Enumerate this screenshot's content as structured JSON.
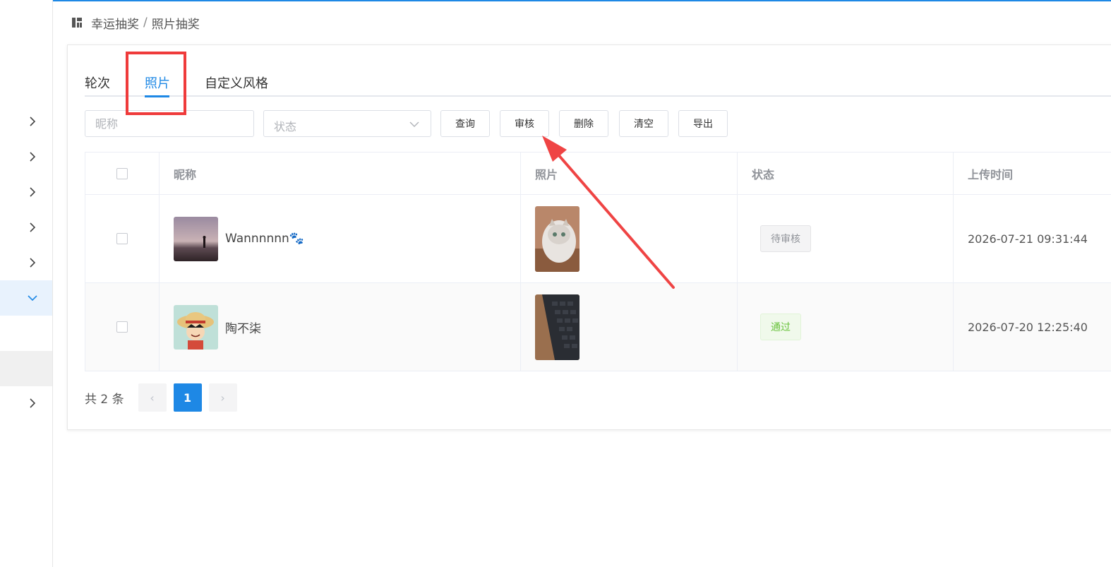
{
  "breadcrumb": {
    "parent": "幸运抽奖",
    "separator": "/",
    "current": "照片抽奖"
  },
  "tabs": [
    {
      "label": "轮次"
    },
    {
      "label": "照片"
    },
    {
      "label": "自定义风格"
    }
  ],
  "filters": {
    "nickname_placeholder": "昵称",
    "status_placeholder": "状态"
  },
  "buttons": {
    "query": "查询",
    "review": "审核",
    "delete": "删除",
    "clear": "清空",
    "export": "导出"
  },
  "table": {
    "columns": [
      "昵称",
      "照片",
      "状态",
      "上传时间"
    ],
    "rows": [
      {
        "nickname": "Wannnnnn🐾",
        "status": "待审核",
        "upload_time": "2026-07-21 09:31:44"
      },
      {
        "nickname": "陶不柒",
        "status": "通过",
        "upload_time": "2026-07-20 12:25:40"
      }
    ]
  },
  "pagination": {
    "total_text": "共 2 条",
    "current_page": "1",
    "prev": "‹",
    "next": "›"
  },
  "colors": {
    "accent": "#1e88e5",
    "annotation": "#ef3b3b",
    "passed": "#67c23a"
  }
}
